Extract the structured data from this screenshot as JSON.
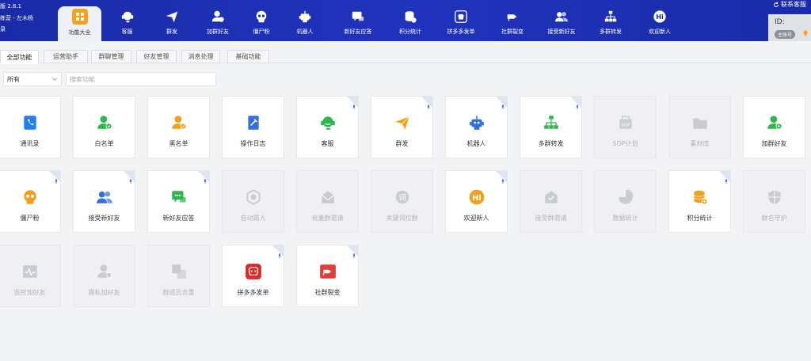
{
  "app": {
    "version": "版 2.8.1",
    "account": "练营 - 左木杨",
    "mode": "录"
  },
  "nav": [
    {
      "label": "功能大全",
      "icon": "grid-icon"
    },
    {
      "label": "客服",
      "icon": "headset-icon"
    },
    {
      "label": "群发",
      "icon": "send-icon"
    },
    {
      "label": "加群好友",
      "icon": "add-user-icon"
    },
    {
      "label": "僵尸粉",
      "icon": "skull-icon"
    },
    {
      "label": "机器人",
      "icon": "robot-icon"
    },
    {
      "label": "新好友应答",
      "icon": "chat-reply-icon"
    },
    {
      "label": "积分统计",
      "icon": "coins-icon"
    },
    {
      "label": "拼多多发单",
      "icon": "pdd-icon"
    },
    {
      "label": "社群裂变",
      "icon": "split-icon"
    },
    {
      "label": "接受新好友",
      "icon": "users-icon"
    },
    {
      "label": "多群转发",
      "icon": "tree-icon"
    },
    {
      "label": "欢迎新人",
      "icon": "hi-icon"
    }
  ],
  "header_right": {
    "service": "联系客服",
    "id_label": "ID:",
    "badge": "主账号"
  },
  "tabs": [
    "全部功能",
    "运营助手",
    "群聊管理",
    "好友管理",
    "消息处理",
    "基础功能"
  ],
  "filter": {
    "selected": "所有",
    "search_placeholder": "搜索功能"
  },
  "cards": [
    {
      "label": "通讯录",
      "icon": "contacts-icon",
      "color": "#1f7ff0",
      "disabled": false,
      "pinned": false
    },
    {
      "label": "白名单",
      "icon": "user-check-icon",
      "color": "#2cb84f",
      "disabled": false,
      "pinned": false
    },
    {
      "label": "黑名单",
      "icon": "user-block-icon",
      "color": "#f2a01b",
      "disabled": false,
      "pinned": false
    },
    {
      "label": "操作日志",
      "icon": "log-icon",
      "color": "#2f6fe0",
      "disabled": false,
      "pinned": false
    },
    {
      "label": "客服",
      "icon": "headset-icon",
      "color": "#2cb84f",
      "disabled": false,
      "pinned": true
    },
    {
      "label": "群发",
      "icon": "send-icon",
      "color": "#f2a01b",
      "disabled": false,
      "pinned": true
    },
    {
      "label": "机器人",
      "icon": "robot-icon",
      "color": "#2f6fe0",
      "disabled": false,
      "pinned": true
    },
    {
      "label": "多群转发",
      "icon": "tree-icon",
      "color": "#2cb84f",
      "disabled": false,
      "pinned": true
    },
    {
      "label": "SOP计划",
      "icon": "sop-icon",
      "color": "#c8cbd1",
      "disabled": true,
      "pinned": false
    },
    {
      "label": "素材库",
      "icon": "folder-icon",
      "color": "#c8cbd1",
      "disabled": true,
      "pinned": false
    },
    {
      "label": "加群好友",
      "icon": "add-user-icon",
      "color": "#2cb84f",
      "disabled": false,
      "pinned": false
    },
    {
      "label": "僵尸粉",
      "icon": "skull-icon",
      "color": "#f2a01b",
      "disabled": false,
      "pinned": true
    },
    {
      "label": "接受新好友",
      "icon": "users-icon",
      "color": "#2f6fe0",
      "disabled": false,
      "pinned": true
    },
    {
      "label": "新好友应答",
      "icon": "chat-reply-icon",
      "color": "#2cb84f",
      "disabled": false,
      "pinned": true
    },
    {
      "label": "自动踢人",
      "icon": "kick-icon",
      "color": "#c8cbd1",
      "disabled": true,
      "pinned": false
    },
    {
      "label": "批量群邀请",
      "icon": "invite-icon",
      "color": "#c8cbd1",
      "disabled": true,
      "pinned": false
    },
    {
      "label": "关键词拉群",
      "icon": "keyword-icon",
      "color": "#c8cbd1",
      "disabled": true,
      "pinned": false
    },
    {
      "label": "欢迎新人",
      "icon": "hi-icon",
      "color": "#f2a01b",
      "disabled": false,
      "pinned": true
    },
    {
      "label": "接受群邀请",
      "icon": "accept-invite-icon",
      "color": "#c8cbd1",
      "disabled": true,
      "pinned": false
    },
    {
      "label": "数据统计",
      "icon": "pie-icon",
      "color": "#c8cbd1",
      "disabled": true,
      "pinned": false
    },
    {
      "label": "积分统计",
      "icon": "coins-icon",
      "color": "#f2a01b",
      "disabled": false,
      "pinned": true
    },
    {
      "label": "群名守护",
      "icon": "shield-icon",
      "color": "#c8cbd1",
      "disabled": true,
      "pinned": false
    },
    {
      "label": "监控加好友",
      "icon": "monitor-icon",
      "color": "#c8cbd1",
      "disabled": true,
      "pinned": false
    },
    {
      "label": "踢私加好友",
      "icon": "private-add-icon",
      "color": "#c8cbd1",
      "disabled": true,
      "pinned": false
    },
    {
      "label": "群成员去重",
      "icon": "dedupe-icon",
      "color": "#c8cbd1",
      "disabled": true,
      "pinned": false
    },
    {
      "label": "拼多多发单",
      "icon": "pdd-icon",
      "color": "#e02828",
      "disabled": false,
      "pinned": true
    },
    {
      "label": "社群裂变",
      "icon": "split-icon",
      "color": "#e0403a",
      "disabled": false,
      "pinned": true
    }
  ]
}
